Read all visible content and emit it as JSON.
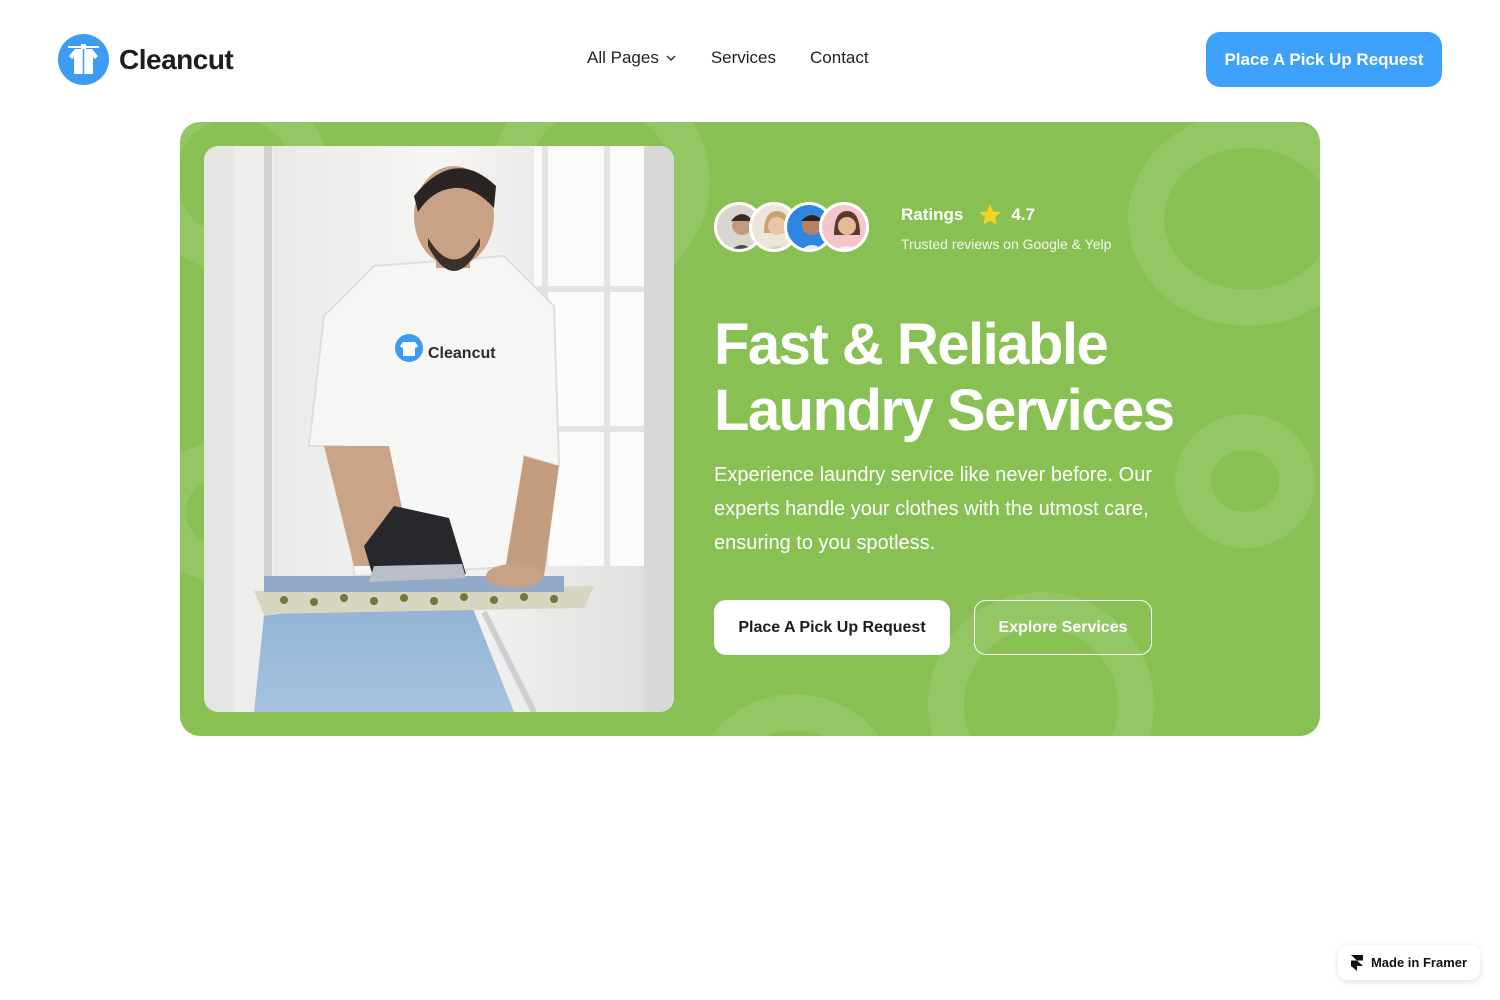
{
  "brand": {
    "name": "Cleancut",
    "accent": "#3da0fb",
    "hero_bg": "#88c053"
  },
  "nav": {
    "items": [
      {
        "label": "All Pages",
        "has_dropdown": true
      },
      {
        "label": "Services",
        "has_dropdown": false
      },
      {
        "label": "Contact",
        "has_dropdown": false
      }
    ]
  },
  "header": {
    "cta_label": "Place A Pick Up Request"
  },
  "hero": {
    "photo_shirt_text": "Cleancut",
    "rating": {
      "label": "Ratings",
      "value": "4.7",
      "subtitle": "Trusted reviews on Google & Yelp"
    },
    "title_line1": "Fast & Reliable",
    "title_line2": "Laundry Services",
    "description": "Experience laundry service like never before. Our experts handle your clothes with the utmost care, ensuring to you spotless.",
    "primary_cta": "Place A Pick Up Request",
    "secondary_cta": "Explore Services"
  },
  "badge": {
    "label": "Made in Framer",
    "icon": "framer-icon"
  }
}
